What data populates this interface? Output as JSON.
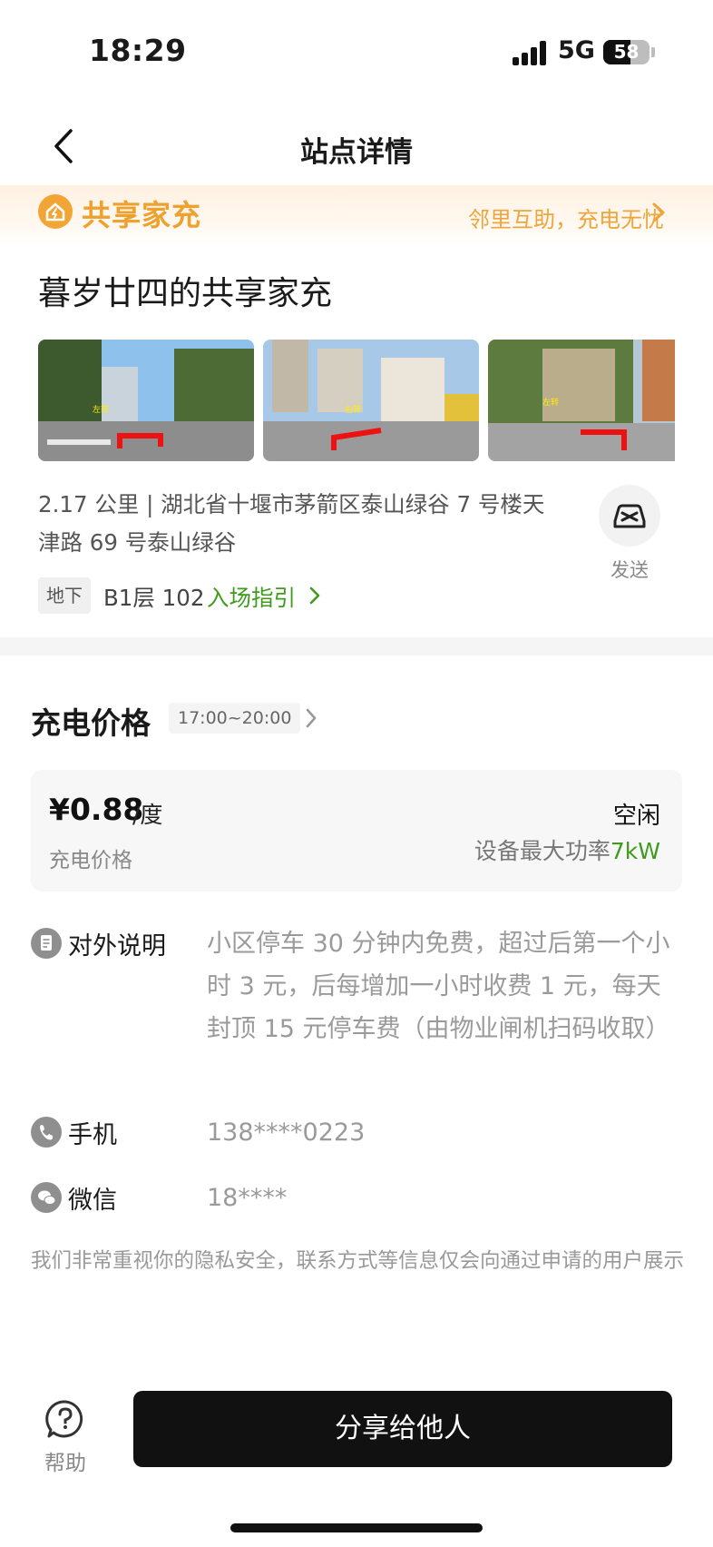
{
  "status_bar": {
    "time": "18:29",
    "network": "5G",
    "battery": "58",
    "battery_level": 0.58
  },
  "nav": {
    "title": "站点详情"
  },
  "banner": {
    "name": "共享家充",
    "slogan": "邻里互助，充电无忧"
  },
  "station": {
    "name": "暮岁廿四的共享家充",
    "photos": [
      {
        "overlay": "左转",
        "turn": "right"
      },
      {
        "overlay": "右转",
        "turn": "right"
      },
      {
        "overlay": "左转",
        "turn": "left"
      }
    ],
    "address": "2.17 公里 | 湖北省十堰市茅箭区泰山绿谷 7 号楼天津路 69 号泰山绿谷",
    "send_label": "发送",
    "floor_tag": "地下",
    "floor_no": "B1层 102",
    "entry_guide": "入场指引"
  },
  "price": {
    "title": "充电价格",
    "time_range": "17:00~20:00",
    "value": "¥0.88",
    "unit": "/度",
    "label": "充电价格",
    "status": "空闲",
    "max_power_label": "设备最大功率",
    "max_power_value": "7kW"
  },
  "info": {
    "note_label": "对外说明",
    "note_value": "小区停车 30 分钟内免费，超过后第一个小时 3 元，后每增加一小时收费 1 元，每天封顶 15 元停车费（由物业闸机扫码收取）",
    "phone_label": "手机",
    "phone_value": "138****0223",
    "wechat_label": "微信",
    "wechat_value": "18****",
    "privacy": "我们非常重视你的隐私安全，联系方式等信息仅会向通过申请的用户展示"
  },
  "bottom": {
    "help_label": "帮助",
    "share_label": "分享给他人"
  },
  "colors": {
    "accent_orange": "#efa12f",
    "accent_green": "#3e9b1c",
    "button_dark": "#111111"
  }
}
